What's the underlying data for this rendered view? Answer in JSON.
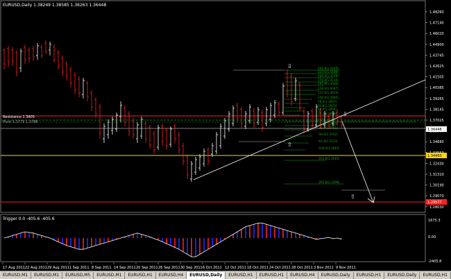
{
  "window": {
    "title": "EURUSD,Daily  1.38249 1.38585 1.36263 1.36448",
    "indicator_title": "Trigger 0.0 -405.6 -405.6"
  },
  "price_axis": {
    "labels": [
      "1.48260",
      "1.47140",
      "1.46020",
      "1.44900",
      "1.43745",
      "1.42625",
      "1.41505",
      "1.40385",
      "1.39265",
      "1.38145",
      "1.37025",
      "1.35800",
      "1.34680",
      "1.33550",
      "1.32430",
      "1.31310",
      "1.30190",
      "1.29070",
      "1.28030"
    ],
    "badges": [
      {
        "text": "1.36448",
        "bg": "#ffffff",
        "fg": "#000000"
      },
      {
        "text": "1.34493",
        "bg": "#ffd700",
        "fg": "#000000"
      },
      {
        "text": "1.29577",
        "bg": "#ff2020",
        "fg": "#ffffff"
      }
    ]
  },
  "indicator_axis": {
    "top": "1675.3",
    "mid": "0.00",
    "bottom": "-2405.8"
  },
  "date_axis": [
    "17 Aug 2011",
    "22 Aug 2011",
    "29 Aug 2011",
    "1 Sep 2011",
    "8 Sep 2011",
    "14 Sep 2011",
    "20 Sep 2011",
    "26 Sep 2011",
    "30 Sep 2011",
    "6 Oct 2011",
    "12 Oct 2011",
    "18 Oct 2011",
    "24 Oct 2011",
    "28 Oct 2011",
    "3 Nov 2011",
    "9 Nov 2011"
  ],
  "fib_labels": [
    "261.8(1.4249)",
    "223.6(1.4186)",
    "200.0(1.4148)",
    "176.4(1.4110)",
    "161.8(1.4086)",
    "138.2(1.4047)",
    "123.6(1.4024)",
    "100.0(1.3985)",
    "76.4(1.3947)",
    "61.8(1.3923)",
    "50.0(1.3904)",
    "38.2(1.3885)",
    "0.0(1.3823)",
    "-23.6(1.3785)",
    "-38.2(1.3761)",
    "-50.0(1.3742)",
    "-61.8(1.3723)",
    "-100.0(1.3661)",
    "-161.8(1.3561)",
    "-261.8(1.3399)"
  ],
  "line_labels": {
    "left1": "Resistance 1.3805",
    "left2": "Pivot 1.3779 1.3788"
  },
  "tabs": [
    {
      "label": "EURUSD,M1",
      "active": false
    },
    {
      "label": "EURUSD,M1",
      "active": false
    },
    {
      "label": "EURUSD,M5",
      "active": false
    },
    {
      "label": "EURUSD,M1",
      "active": false
    },
    {
      "label": "EURUSD,H1",
      "active": false
    },
    {
      "label": "EURUSD,H4",
      "active": false
    },
    {
      "label": "EURUSD,Daily",
      "active": true
    },
    {
      "label": "EURUSD,H1",
      "active": false
    },
    {
      "label": "EURUSD,H1",
      "active": false
    },
    {
      "label": "EURUSD,H4",
      "active": false
    },
    {
      "label": "EURUSD,Daily",
      "active": false
    },
    {
      "label": "EURUSD,H1",
      "active": false
    },
    {
      "label": "EURUSD,Daily",
      "active": false
    },
    {
      "label": "EURUSD,H1",
      "active": false
    }
  ],
  "colors": {
    "bull": "#ffffff",
    "bear": "#ff2020",
    "fib": "#1aa31a",
    "gold": "#ffd700",
    "red_line": "#ff2020",
    "trend": "#ffffff",
    "hist_pos": "#2a2aff",
    "hist_neg": "#ff2020"
  }
}
